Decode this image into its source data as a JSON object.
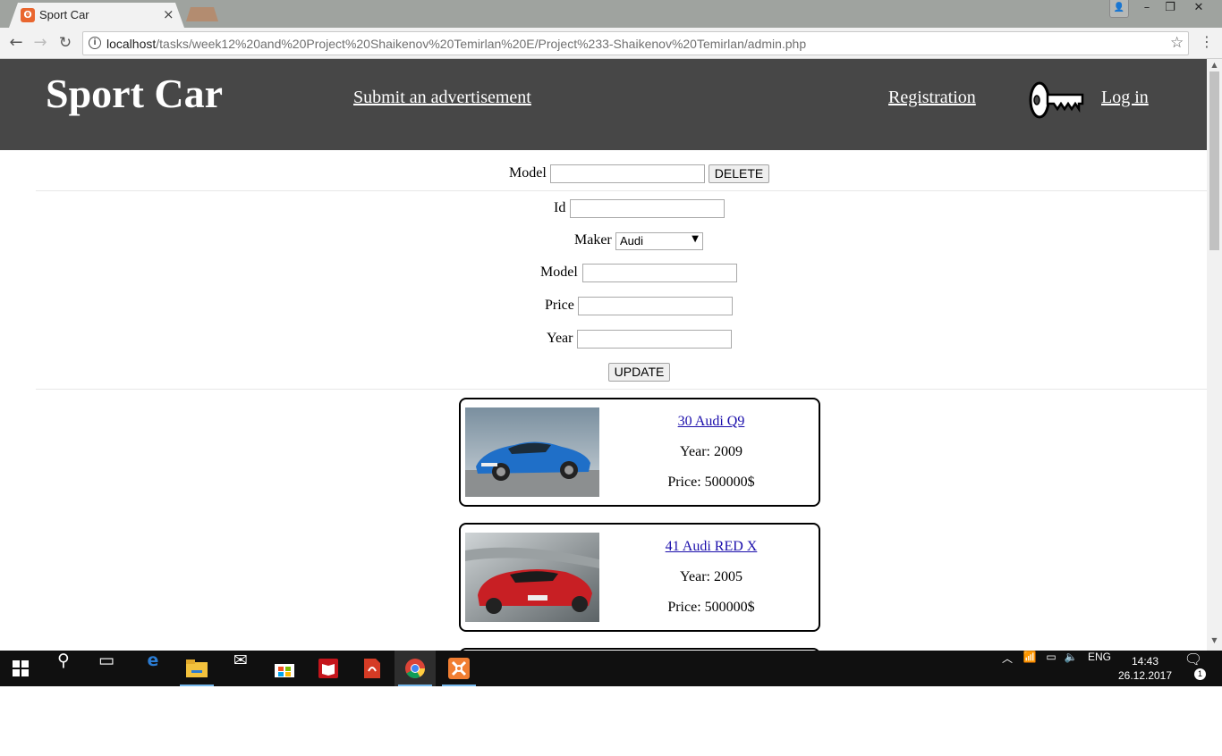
{
  "browser": {
    "tab_title": "Sport Car",
    "url_host": "localhost",
    "url_path": "/tasks/week12%20and%20Project%20Shaikenov%20Temirlan%20E/Project%233-Shaikenov%20Temirlan/admin.php"
  },
  "header": {
    "site_title": "Sport Car",
    "submit_link": "Submit an advertisement",
    "registration_link": "Registration",
    "login_link": "Log in"
  },
  "delete_form": {
    "model_label": "Model",
    "model_value": "",
    "delete_button": "DELETE"
  },
  "update_form": {
    "id_label": "Id",
    "id_value": "",
    "maker_label": "Maker",
    "maker_selected": "Audi",
    "model_label": "Model",
    "model_value": "",
    "price_label": "Price",
    "price_value": "",
    "year_label": "Year",
    "year_value": "",
    "update_button": "UPDATE"
  },
  "cars": [
    {
      "title": "30 Audi Q9",
      "year": "Year: 2009",
      "price": "Price: 500000$",
      "color": "#2a7ad6"
    },
    {
      "title": "41 Audi RED X",
      "year": "Year: 2005",
      "price": "Price: 500000$",
      "color": "#d02a2a"
    }
  ],
  "taskbar": {
    "language": "ENG",
    "time": "14:43",
    "date": "26.12.2017",
    "notification_count": "1"
  },
  "colors": {
    "header_bg": "#474747",
    "link_visited": "#1a0dab",
    "taskbar_bg": "#101010"
  }
}
